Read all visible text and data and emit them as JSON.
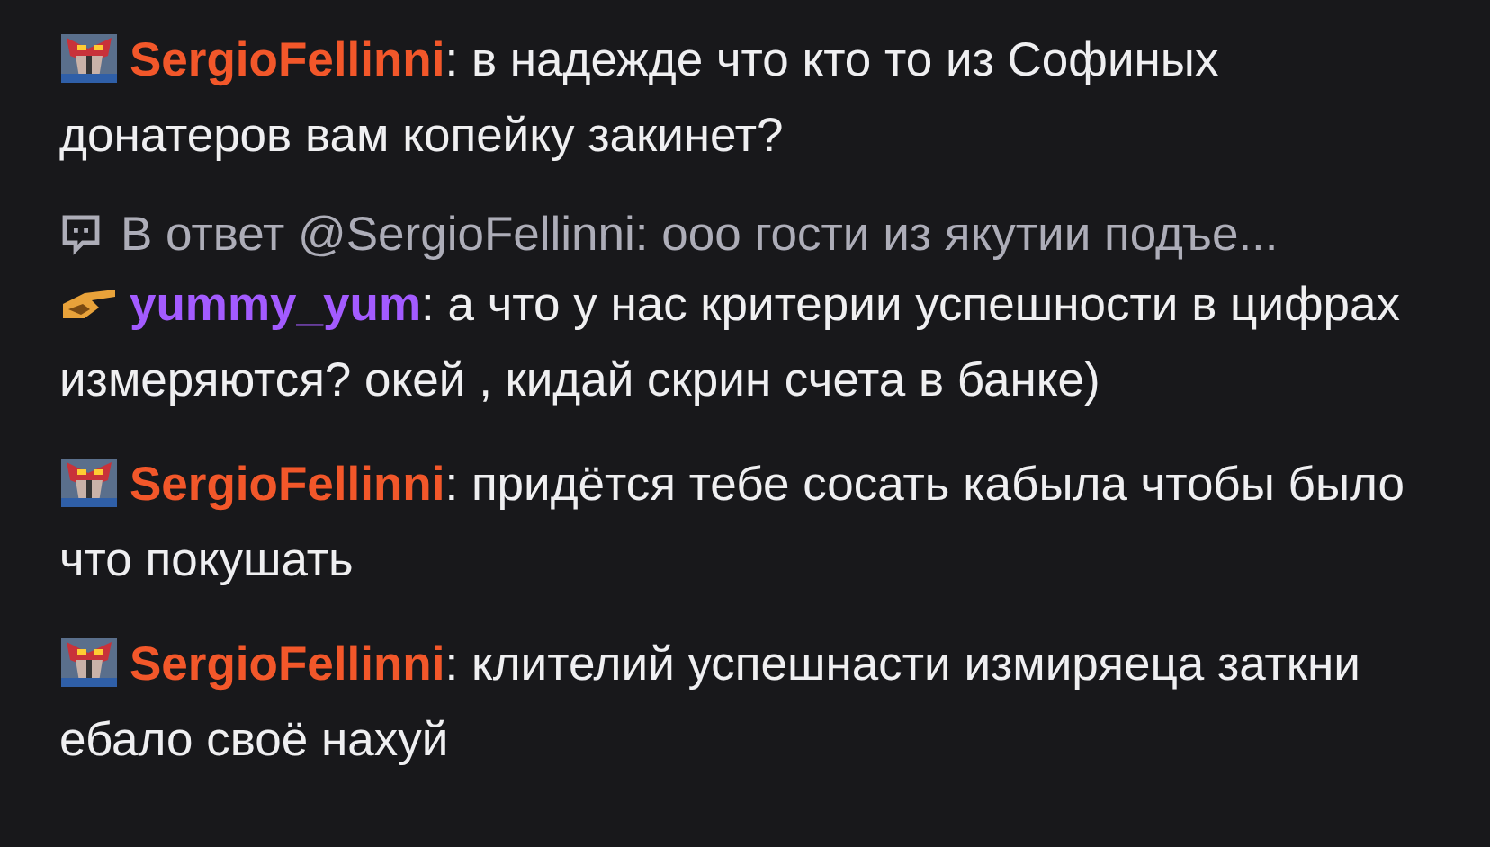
{
  "messages": [
    {
      "badge": {
        "kind": "sub"
      },
      "user": "SergioFellinni",
      "color": "#f2572a",
      "separator": ":",
      "text": "в надежде что кто то из Софиных донатеров вам копейку закинет?"
    },
    {
      "badge": {
        "kind": "hand"
      },
      "user": "yummy_yum",
      "color": "#a35bff",
      "separator": ":",
      "text": "а что у нас критерии успешности в цифрах измеряются? окей , кидай скрин счета в банке)",
      "reply": "В ответ @SergioFellinni: ооо гости из якутии подъе..."
    },
    {
      "badge": {
        "kind": "sub"
      },
      "user": "SergioFellinni",
      "color": "#f2572a",
      "separator": ":",
      "text": "придётся тебе сосать кабыла чтобы было что покушать"
    },
    {
      "badge": {
        "kind": "sub"
      },
      "user": "SergioFellinni",
      "color": "#f2572a",
      "separator": ":",
      "text": "клителий успешнасти измиряеца заткни ебало своё нахуй"
    }
  ]
}
